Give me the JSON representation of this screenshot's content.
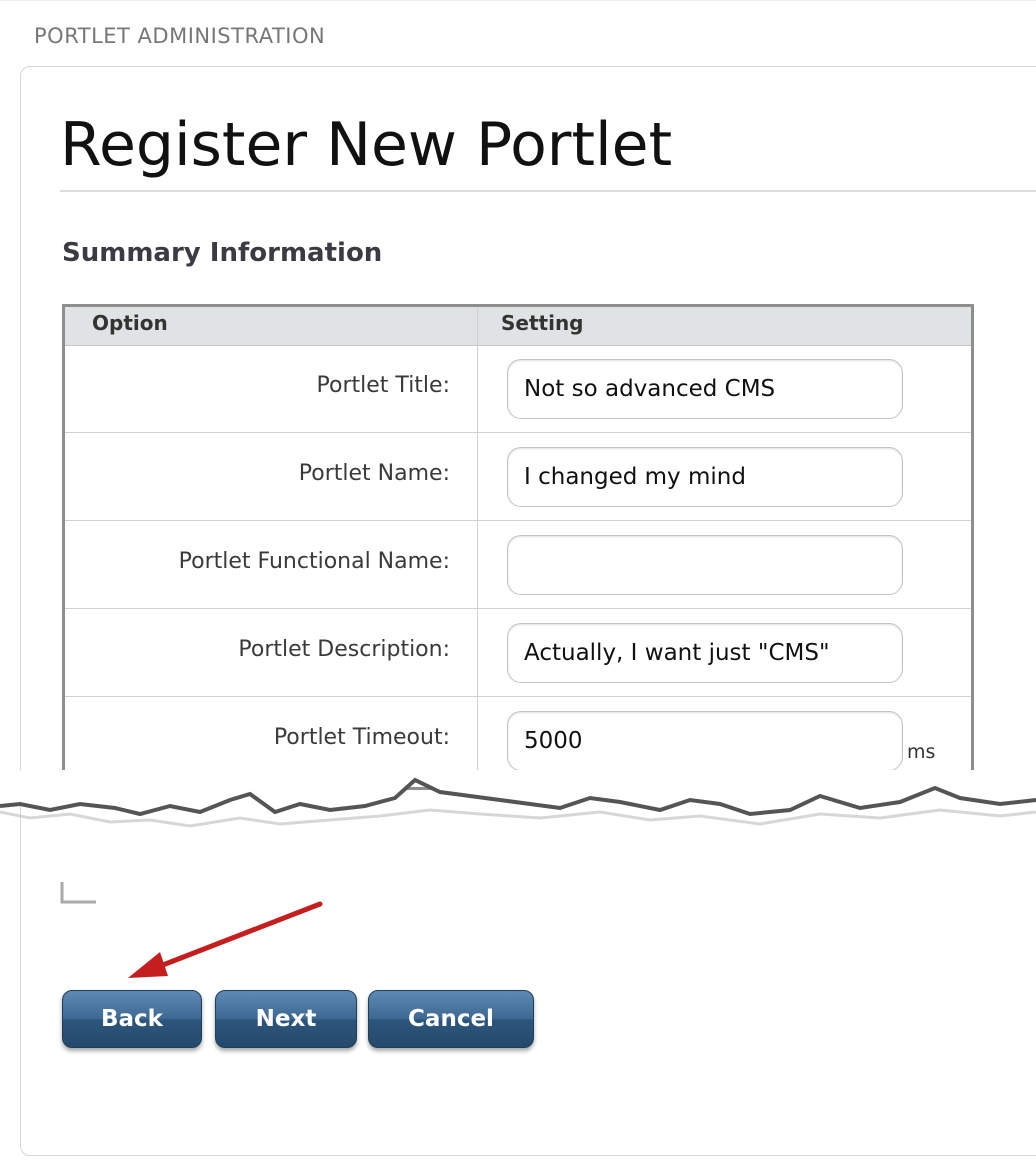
{
  "header": {
    "admin_label": "PORTLET ADMINISTRATION"
  },
  "page": {
    "title": "Register New Portlet",
    "section_heading": "Summary Information"
  },
  "table": {
    "columns": [
      "Option",
      "Setting"
    ],
    "rows": [
      {
        "label": "Portlet Title:",
        "value": "Not so advanced CMS",
        "unit": ""
      },
      {
        "label": "Portlet Name:",
        "value": "I changed my mind",
        "unit": ""
      },
      {
        "label": "Portlet Functional Name:",
        "value": "",
        "unit": ""
      },
      {
        "label": "Portlet Description:",
        "value": "Actually, I want just \"CMS\"",
        "unit": ""
      },
      {
        "label": "Portlet Timeout:",
        "value": "5000",
        "unit": "ms"
      }
    ]
  },
  "buttons": {
    "back": "Back",
    "next": "Next",
    "cancel": "Cancel"
  },
  "colors": {
    "button_blue": "#2d567c",
    "arrow_red": "#c41e1e",
    "table_header_bg": "#dfe3e3"
  },
  "icons": {
    "annotation_arrow": "red-arrow-icon"
  }
}
